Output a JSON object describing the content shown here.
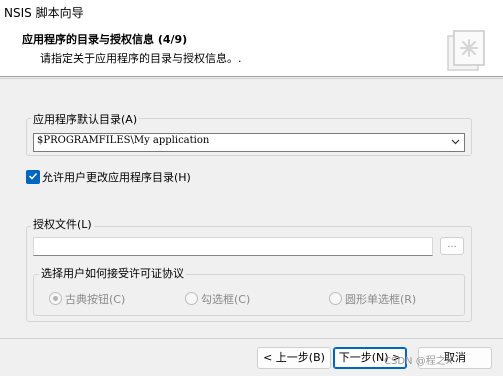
{
  "window": {
    "title": "NSIS 脚本向导"
  },
  "header": {
    "title": "应用程序的目录与授权信息 (4/9)",
    "subtitle": "请指定关于应用程序的目录与授权信息。."
  },
  "install_dir": {
    "group_label": "应用程序默认目录(A)",
    "value": "$PROGRAMFILES\\My application",
    "allow_change_label": "允许用户更改应用程序目录(H)",
    "allow_change_checked": true
  },
  "license": {
    "group_label": "授权文件(L)",
    "file_value": "",
    "browse_label": "...",
    "accept_group_label": "选择用户如何接受许可证协议",
    "options": [
      {
        "label": "古典按钮(C)",
        "checked": true
      },
      {
        "label": "勾选框(C)",
        "checked": false
      },
      {
        "label": "圆形单选框(R)",
        "checked": false
      }
    ]
  },
  "buttons": {
    "back": "< 上一步(B)",
    "next": "下一步(N) >",
    "cancel": "取消"
  },
  "watermark": "CSDN @程之X",
  "colors": {
    "accent": "#0067c0"
  },
  "icons": {
    "logo": "wizard-logo-icon",
    "combo_arrow": "chevron-down-icon",
    "checkmark": "checkmark-icon"
  }
}
